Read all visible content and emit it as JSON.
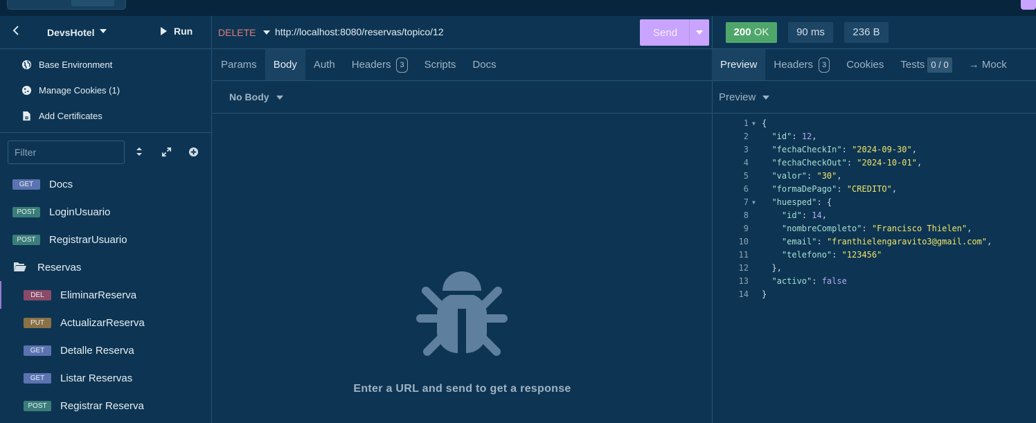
{
  "workspace": {
    "name": "DevsHotel",
    "run_label": "Run"
  },
  "sidebar": {
    "env_items": [
      {
        "label": "Base Environment",
        "icon": "globe-icon"
      },
      {
        "label": "Manage Cookies (1)",
        "icon": "cookie-icon"
      },
      {
        "label": "Add Certificates",
        "icon": "certificate-icon"
      }
    ],
    "filter_placeholder": "Filter",
    "requests": [
      {
        "method": "GET",
        "label": "Docs"
      },
      {
        "method": "POST",
        "label": "LoginUsuario"
      },
      {
        "method": "POST",
        "label": "RegistrarUsuario"
      }
    ],
    "folder": "Reservas",
    "folder_requests": [
      {
        "method": "DEL",
        "label": "EliminarReserva"
      },
      {
        "method": "PUT",
        "label": "ActualizarReserva"
      },
      {
        "method": "GET",
        "label": "Detalle Reserva"
      },
      {
        "method": "GET",
        "label": "Listar Reservas"
      },
      {
        "method": "POST",
        "label": "Registrar Reserva"
      }
    ]
  },
  "request": {
    "method": "DELETE",
    "url": "http://localhost:8080/reservas/topico/12",
    "send_label": "Send",
    "tabs": [
      "Params",
      "Body",
      "Auth",
      "Headers",
      "Scripts",
      "Docs"
    ],
    "headers_count": "3",
    "body_mode": "No Body",
    "empty_message": "Enter a URL and send to get a response"
  },
  "response": {
    "status_code": "200",
    "status_text": "OK",
    "time": "90 ms",
    "size": "236 B",
    "tabs": [
      "Preview",
      "Headers",
      "Cookies",
      "Tests",
      "→ Mock"
    ],
    "headers_count": "3",
    "tests_count": "0 / 0",
    "preview_mode": "Preview",
    "line_numbers": [
      "1",
      "2",
      "3",
      "4",
      "5",
      "6",
      "7",
      "8",
      "9",
      "10",
      "11",
      "12",
      "13",
      "14"
    ]
  },
  "colors": {
    "background": "#0d3553",
    "send_button": "#c9a4ff",
    "status_ok": "#4fa66b",
    "method_delete": "#e37b7b"
  }
}
